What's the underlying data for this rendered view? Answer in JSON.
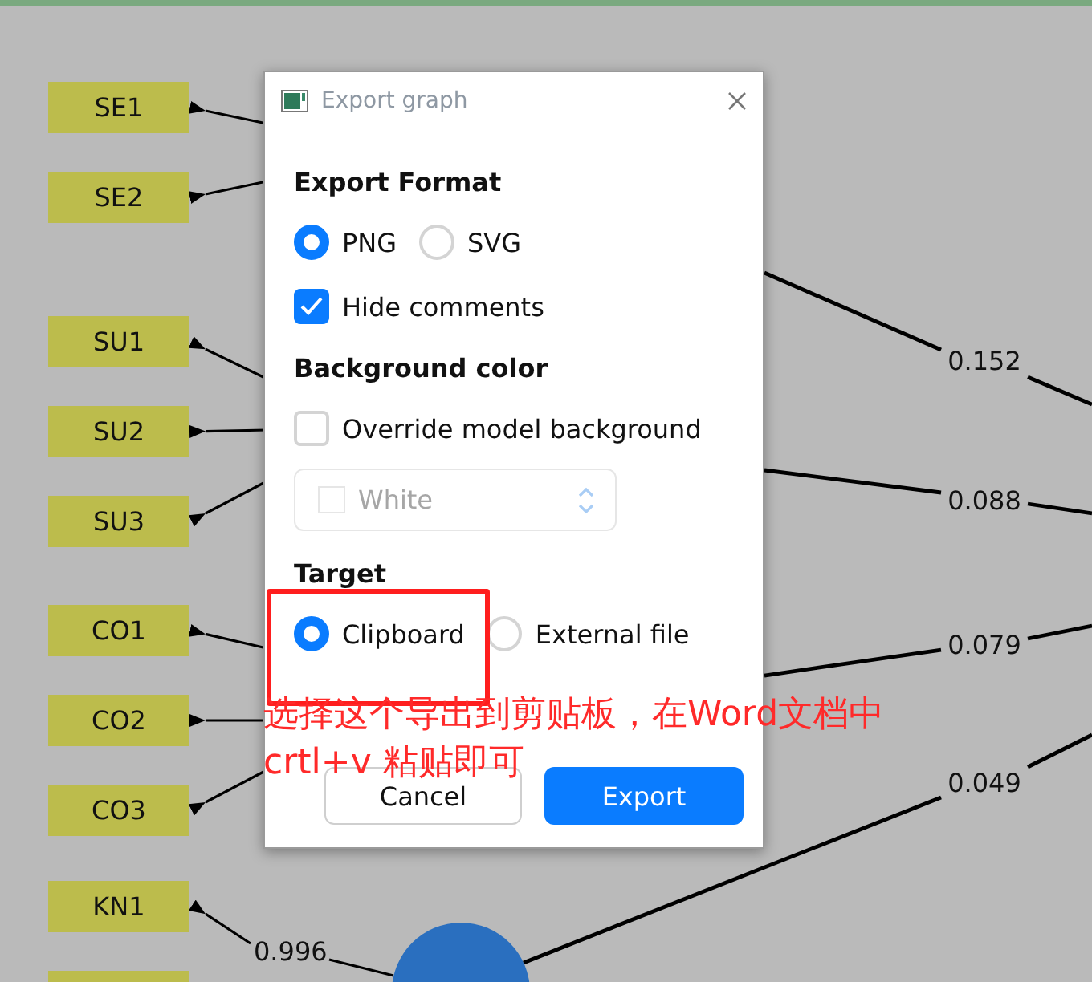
{
  "canvas": {
    "nodes": [
      {
        "label": "SE1"
      },
      {
        "label": "SE2"
      },
      {
        "label": "SU1"
      },
      {
        "label": "SU2"
      },
      {
        "label": "SU3"
      },
      {
        "label": "CO1"
      },
      {
        "label": "CO2"
      },
      {
        "label": "CO3"
      },
      {
        "label": "KN1",
        "weight": "0.996"
      }
    ],
    "path_weights": [
      "0.152",
      "0.088",
      "0.079",
      "0.049"
    ]
  },
  "dialog": {
    "title": "Export graph",
    "sections": [
      {
        "heading": "Export Format",
        "controls": [
          {
            "kind": "radio_group",
            "options": [
              {
                "label": "PNG",
                "selected": true
              },
              {
                "label": "SVG",
                "selected": false
              }
            ]
          },
          {
            "kind": "checkbox",
            "label": "Hide comments",
            "checked": true
          }
        ]
      },
      {
        "heading": "Background color",
        "controls": [
          {
            "kind": "checkbox",
            "label": "Override model background",
            "checked": false
          },
          {
            "kind": "select",
            "value": "White",
            "disabled": true
          }
        ]
      },
      {
        "heading": "Target",
        "controls": [
          {
            "kind": "radio_group",
            "options": [
              {
                "label": "Clipboard",
                "selected": true
              },
              {
                "label": "External file",
                "selected": false
              }
            ]
          }
        ]
      }
    ],
    "buttons": [
      {
        "label": "Cancel",
        "kind": "secondary"
      },
      {
        "label": "Export",
        "kind": "primary"
      }
    ]
  },
  "annotation": {
    "lines": [
      "选择这个导出到剪贴板，在Word文档中",
      "crtl+v 粘贴即可"
    ]
  }
}
